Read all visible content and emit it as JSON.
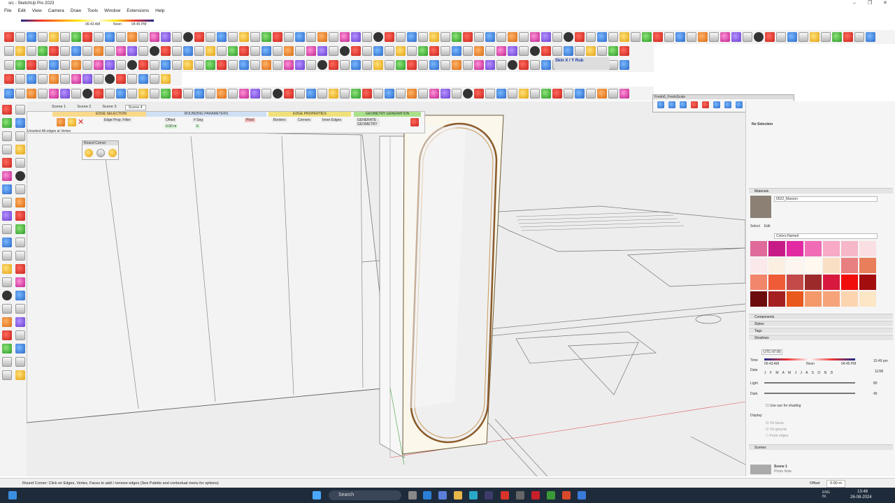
{
  "window": {
    "title": "src - SketchUp Pro 2023"
  },
  "menu": [
    "File",
    "Edit",
    "View",
    "Camera",
    "Draw",
    "Tools",
    "Window",
    "Extensions",
    "Help"
  ],
  "scene_tabs": [
    "Scene 1",
    "Scene 2",
    "Scene 3",
    "Scene 4"
  ],
  "roundcorner": {
    "sections": [
      "EDGE SELECTION",
      "ROUNDING PARAMETERS",
      "EDGE PROPERTIES",
      "GEOMETRY GENERATION"
    ],
    "edge_prop_filter": "Edge Prop. Filter",
    "offset_label": "Offset",
    "offset_value": "0.00 m",
    "seg_label": "# Seg",
    "seg_value": "6",
    "pixel_label": "Pixel",
    "borders": "Borders",
    "corners": "Corners",
    "inner_edges": "Inner Edges",
    "generate": "GENERATE GEOMETRY",
    "unselect_hint": "Unselect All edges at Vertex",
    "palette_title": "Round Corner"
  },
  "fredo_toolbar": {
    "title": "Fredo6_FredoScale"
  },
  "skin_label": "Skin X / Y Rub",
  "sun_time_labels": {
    "start": "06:43 AM",
    "noon": "Noon",
    "end": "04:45 PM"
  },
  "tray": {
    "entity_info": "No Selection",
    "materials_header": "Materials",
    "material_name": "0522_Maroon",
    "select_tab": "Select",
    "edit_tab": "Edit",
    "collection": "Colors-Named",
    "components": "Components",
    "styles": "Styles",
    "tags": "Tags",
    "shadows": "Shadows",
    "utc": "UTC-07:00",
    "time_label": "Time",
    "time_start": "06:43 AM",
    "time_noon": "Noon",
    "time_end": "04:45 PM",
    "time_value": "15:49 pm",
    "date_label": "Date",
    "date_value": "11/08",
    "months": "J F M A M J J A S O N D",
    "light_label": "Light",
    "light_value": "80",
    "dark_label": "Dark",
    "dark_value": "45",
    "use_sun": "Use sun for shading",
    "display_label": "Display:",
    "on_faces": "On faces",
    "on_ground": "On ground",
    "from_edges": "From edges",
    "scenes": "Scenes",
    "scene_name": "Scene 1",
    "scene_desc": "Photo Note"
  },
  "swatch_colors": [
    "#e06a9a",
    "#c71c87",
    "#e22aa2",
    "#f06cb5",
    "#f7a9c6",
    "#f6b7c8",
    "#f9dfe2",
    "#fbe8ea",
    "#fbefe2",
    "#fdf6ee",
    "#fff9f0",
    "#f9dfc3",
    "#e87f80",
    "#e97f5a",
    "#f1866b",
    "#ef5b36",
    "#c44a4a",
    "#9c2a2a",
    "#d8193d",
    "#f20d0d",
    "#a30d0d",
    "#6c0c0c",
    "#a52020",
    "#e9581c",
    "#f49a6a",
    "#f6a37a",
    "#fbd5b0",
    "#fbe6c6"
  ],
  "status": {
    "text": "Round Corner: Click on Edges, Vertex, Faces to add / remove edges (See Palette and contextual menu for options)",
    "vcb_label": "Offset",
    "vcb_value": "0.00 m"
  },
  "taskbar": {
    "search": "Search",
    "lang": "ENG IN",
    "time": "13:48",
    "date": "26-08-2024"
  }
}
